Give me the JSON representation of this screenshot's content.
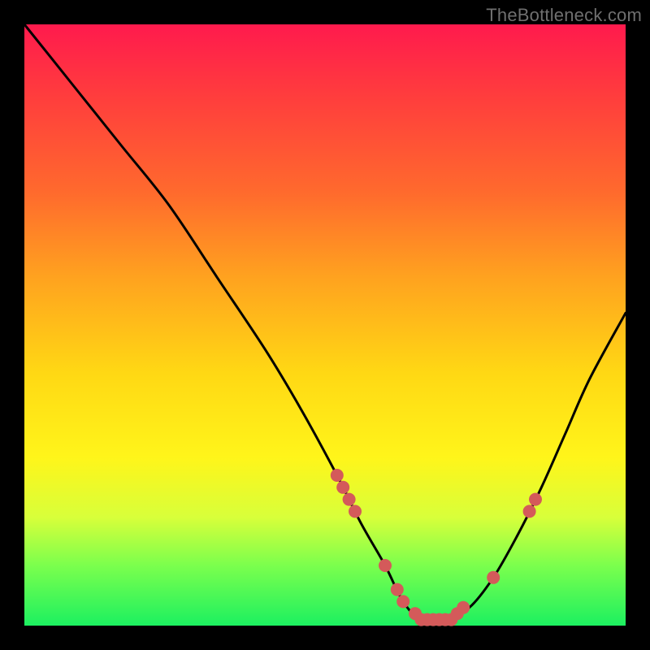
{
  "watermark": "TheBottleneck.com",
  "colors": {
    "frame": "#000000",
    "curve": "#000000",
    "marker": "#d45a5a",
    "gradient_top": "#ff1a4d",
    "gradient_mid1": "#ffa21f",
    "gradient_mid2": "#fff51a",
    "gradient_bottom": "#1cf060"
  },
  "chart_data": {
    "type": "line",
    "title": "",
    "xlabel": "",
    "ylabel": "",
    "xlim": [
      0,
      100
    ],
    "ylim": [
      0,
      100
    ],
    "note": "Axes are unlabeled; values are read as percentages of the plot area. y=0 is at the bottom (green zone), y=100 is at the top (red zone). The curve is a V-shape reaching its minimum (~y=1) around x=66, rising to ~y=100 at x=0 and ~y=52 at x=100.",
    "series": [
      {
        "name": "curve",
        "x": [
          0,
          8,
          16,
          24,
          32,
          40,
          46,
          52,
          56,
          60,
          63,
          66,
          70,
          74,
          78,
          82,
          86,
          90,
          94,
          100
        ],
        "y": [
          100,
          90,
          80,
          70,
          58,
          46,
          36,
          25,
          17,
          10,
          4,
          1,
          1,
          3,
          8,
          15,
          23,
          32,
          41,
          52
        ]
      }
    ],
    "markers": {
      "name": "highlighted-points",
      "note": "Pink dots clustered near the trough and along both ascending sides.",
      "x": [
        52,
        53,
        54,
        55,
        60,
        62,
        63,
        65,
        66,
        67,
        68,
        69,
        70,
        71,
        72,
        73,
        78,
        84,
        85
      ],
      "y": [
        25,
        23,
        21,
        19,
        10,
        6,
        4,
        2,
        1,
        1,
        1,
        1,
        1,
        1,
        2,
        3,
        8,
        19,
        21
      ]
    }
  }
}
